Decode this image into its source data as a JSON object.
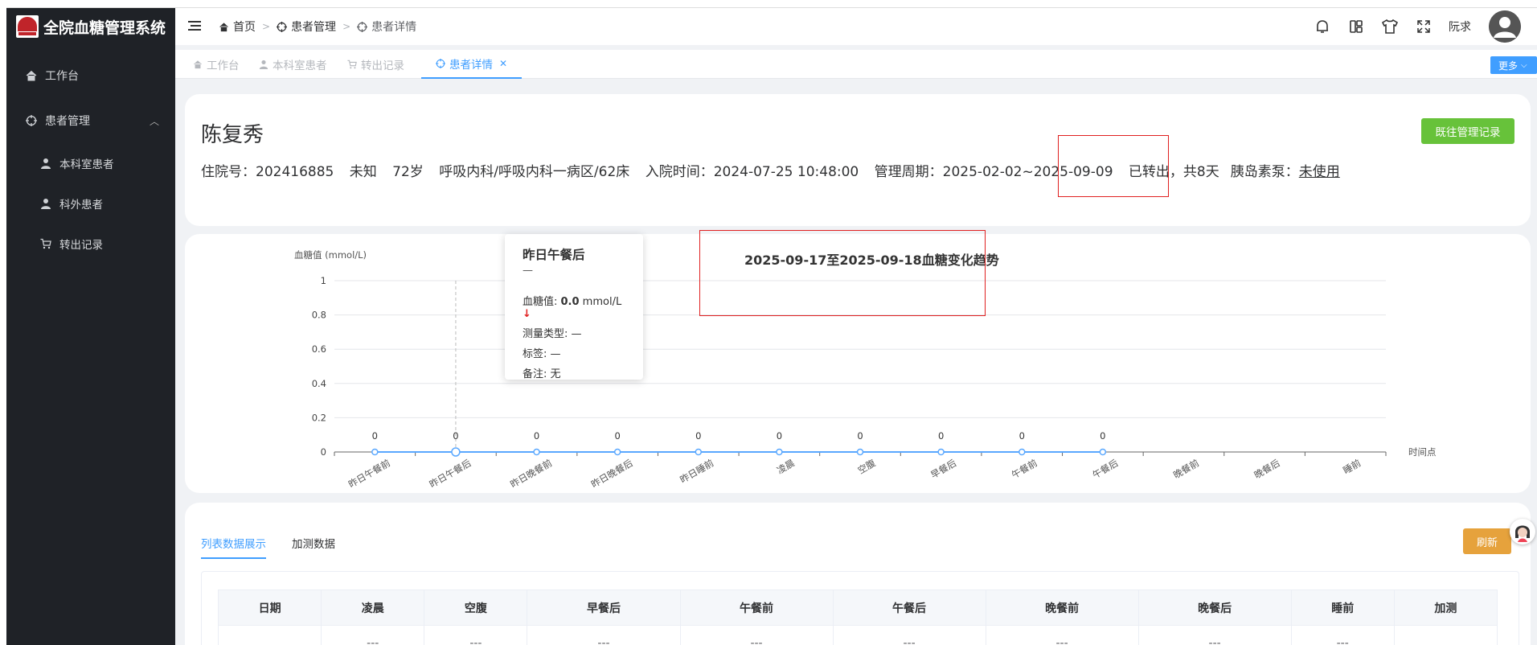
{
  "app": {
    "title": "全院血糖管理系统"
  },
  "sidebar": {
    "items": [
      {
        "label": "工作台"
      },
      {
        "label": "患者管理"
      },
      {
        "label": "本科室患者"
      },
      {
        "label": "科外患者"
      },
      {
        "label": "转出记录"
      }
    ]
  },
  "breadcrumb": [
    "首页",
    "患者管理",
    "患者详情"
  ],
  "header": {
    "username": "阮求"
  },
  "tabs": [
    {
      "label": "工作台"
    },
    {
      "label": "本科室患者"
    },
    {
      "label": "转出记录"
    },
    {
      "label": "患者详情"
    }
  ],
  "more_label": "更多",
  "patient": {
    "name": "陈复秀",
    "admission_label": "住院号：202416885",
    "gender": "未知",
    "age": "72岁",
    "ward": "呼吸内科/呼吸内科一病区/62床",
    "admit_time": "入院时间：2024-07-25 10:48:00",
    "period_label": "管理周期：2025-02-02~2025-09-09",
    "status": "已转出，共8天",
    "insulin_label": "胰岛素泵：",
    "insulin_value": "未使用",
    "history_button": "既往管理记录"
  },
  "chart_data": {
    "type": "line",
    "title": "2025-09-17至2025-09-18血糖变化趋势",
    "ylabel": "血糖值 (mmol/L)",
    "xlabel": "时间点",
    "ylim": [
      0,
      1
    ],
    "yticks": [
      "1",
      "0.8",
      "0.6",
      "0.4",
      "0.2",
      "0"
    ],
    "categories": [
      "昨日午餐前",
      "昨日午餐后",
      "昨日晚餐前",
      "昨日晚餐后",
      "昨日睡前",
      "凌晨",
      "空腹",
      "早餐后",
      "午餐前",
      "午餐后",
      "晚餐前",
      "晚餐后",
      "睡前"
    ],
    "values": [
      0,
      0,
      0,
      0,
      0,
      0,
      0,
      0,
      0,
      0,
      null,
      null,
      null
    ],
    "color": "#5aa8ff"
  },
  "tooltip": {
    "title": "昨日午餐后",
    "dash": "—",
    "glucose_label": "血糖值: ",
    "glucose_value": "0.0",
    "glucose_unit": " mmol/L",
    "arrow": "↓",
    "type_line": "测量类型: —",
    "tag_line": "标签: —",
    "note_line": "备注: 无"
  },
  "data_tabs": {
    "list": "列表数据展示",
    "extra": "加测数据"
  },
  "refresh_label": "刷新",
  "table": {
    "headers": [
      "日期",
      "凌晨",
      "空腹",
      "早餐后",
      "午餐前",
      "午餐后",
      "晚餐前",
      "晚餐后",
      "睡前",
      "加测"
    ],
    "rows": [
      [
        "",
        "---",
        "---",
        "---",
        "---",
        "---",
        "---",
        "---",
        "---",
        ""
      ]
    ]
  }
}
